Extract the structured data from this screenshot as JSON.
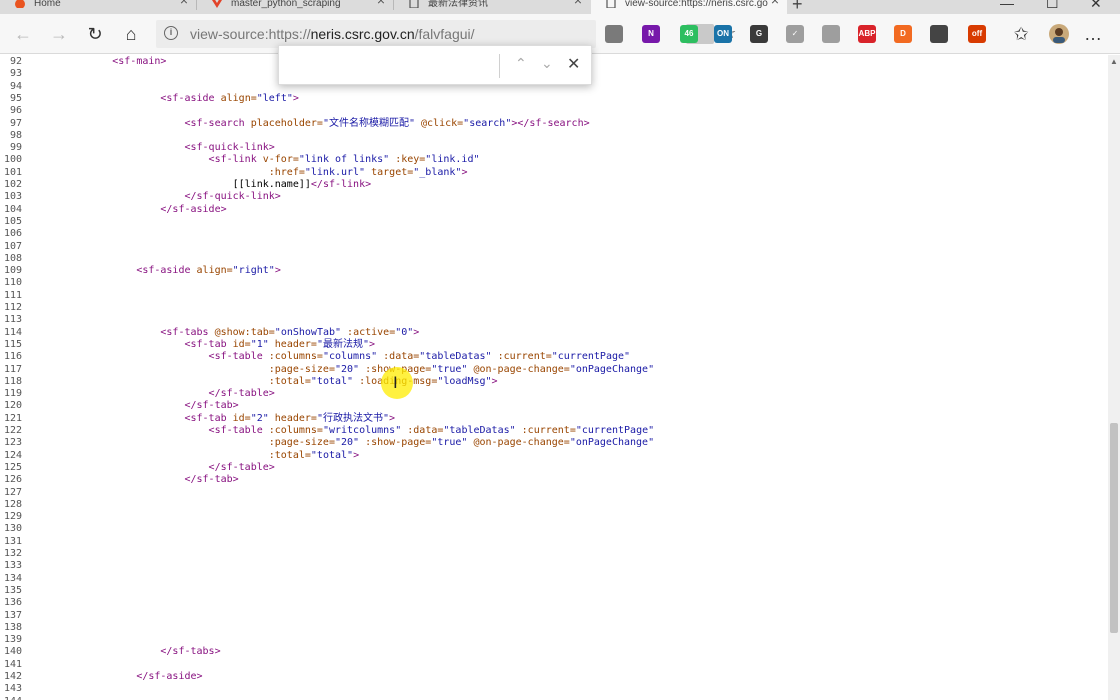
{
  "tabs": [
    {
      "label": "Home",
      "icon": "ubuntu-icon",
      "active": false
    },
    {
      "label": "master_python_scraping",
      "icon": "gitlab-icon",
      "active": false
    },
    {
      "label": "最新法律资讯",
      "icon": "page-icon",
      "active": false
    },
    {
      "label": "view-source:https://neris.csrc.go",
      "icon": "page-icon",
      "active": true
    }
  ],
  "address": {
    "prefix": "view-source:https://",
    "host": "neris.csrc.gov.cn",
    "path": "/falvfagui/"
  },
  "findbar": {
    "value": ""
  },
  "source_lines": [
    {
      "n": "92",
      "indent": 6,
      "tokens": [
        {
          "t": "tag",
          "v": "<sf-main>"
        }
      ]
    },
    {
      "n": "93",
      "indent": 0,
      "tokens": []
    },
    {
      "n": "94",
      "indent": 0,
      "tokens": []
    },
    {
      "n": "95",
      "indent": 10,
      "tokens": [
        {
          "t": "tag",
          "v": "<sf-aside "
        },
        {
          "t": "attr",
          "v": "align="
        },
        {
          "t": "val",
          "v": "\"left\""
        },
        {
          "t": "tag",
          "v": ">"
        }
      ]
    },
    {
      "n": "96",
      "indent": 0,
      "tokens": []
    },
    {
      "n": "97",
      "indent": 12,
      "tokens": [
        {
          "t": "tag",
          "v": "<sf-search "
        },
        {
          "t": "attr",
          "v": "placeholder="
        },
        {
          "t": "val",
          "v": "\"文件名称模糊匹配\""
        },
        {
          "t": "attr",
          "v": " @click="
        },
        {
          "t": "val",
          "v": "\"search\""
        },
        {
          "t": "tag",
          "v": "></sf-search>"
        }
      ]
    },
    {
      "n": "98",
      "indent": 0,
      "tokens": []
    },
    {
      "n": "99",
      "indent": 12,
      "tokens": [
        {
          "t": "tag",
          "v": "<sf-quick-link>"
        }
      ]
    },
    {
      "n": "100",
      "indent": 14,
      "tokens": [
        {
          "t": "tag",
          "v": "<sf-link "
        },
        {
          "t": "attr",
          "v": "v-for="
        },
        {
          "t": "val",
          "v": "\"link of links\""
        },
        {
          "t": "attr",
          "v": " :key="
        },
        {
          "t": "val",
          "v": "\"link.id\""
        }
      ]
    },
    {
      "n": "101",
      "indent": 19,
      "tokens": [
        {
          "t": "attr",
          "v": ":href="
        },
        {
          "t": "val",
          "v": "\"link.url\""
        },
        {
          "t": "attr",
          "v": " target="
        },
        {
          "t": "val",
          "v": "\"_blank\""
        },
        {
          "t": "tag",
          "v": ">"
        }
      ]
    },
    {
      "n": "102",
      "indent": 16,
      "tokens": [
        {
          "t": "txt",
          "v": "[[link.name]]"
        },
        {
          "t": "tag",
          "v": "</sf-link>"
        }
      ]
    },
    {
      "n": "103",
      "indent": 12,
      "tokens": [
        {
          "t": "tag",
          "v": "</sf-quick-link>"
        }
      ]
    },
    {
      "n": "104",
      "indent": 10,
      "tokens": [
        {
          "t": "tag",
          "v": "</sf-aside>"
        }
      ]
    },
    {
      "n": "105",
      "indent": 0,
      "tokens": []
    },
    {
      "n": "106",
      "indent": 0,
      "tokens": []
    },
    {
      "n": "107",
      "indent": 0,
      "tokens": []
    },
    {
      "n": "108",
      "indent": 0,
      "tokens": []
    },
    {
      "n": "109",
      "indent": 8,
      "tokens": [
        {
          "t": "tag",
          "v": "<sf-aside "
        },
        {
          "t": "attr",
          "v": "align="
        },
        {
          "t": "val",
          "v": "\"right\""
        },
        {
          "t": "tag",
          "v": ">"
        }
      ]
    },
    {
      "n": "110",
      "indent": 0,
      "tokens": []
    },
    {
      "n": "111",
      "indent": 0,
      "tokens": []
    },
    {
      "n": "112",
      "indent": 0,
      "tokens": []
    },
    {
      "n": "113",
      "indent": 0,
      "tokens": []
    },
    {
      "n": "114",
      "indent": 10,
      "tokens": [
        {
          "t": "tag",
          "v": "<sf-tabs "
        },
        {
          "t": "attr",
          "v": "@show:tab="
        },
        {
          "t": "val",
          "v": "\"onShowTab\""
        },
        {
          "t": "attr",
          "v": " :active="
        },
        {
          "t": "val",
          "v": "\"0\""
        },
        {
          "t": "tag",
          "v": ">"
        }
      ]
    },
    {
      "n": "115",
      "indent": 12,
      "tokens": [
        {
          "t": "tag",
          "v": "<sf-tab "
        },
        {
          "t": "attr",
          "v": "id="
        },
        {
          "t": "val",
          "v": "\"1\""
        },
        {
          "t": "attr",
          "v": " header="
        },
        {
          "t": "val",
          "v": "\"最新法规\""
        },
        {
          "t": "tag",
          "v": ">"
        }
      ]
    },
    {
      "n": "116",
      "indent": 14,
      "tokens": [
        {
          "t": "tag",
          "v": "<sf-table "
        },
        {
          "t": "attr",
          "v": ":columns="
        },
        {
          "t": "val",
          "v": "\"columns\""
        },
        {
          "t": "attr",
          "v": " :data="
        },
        {
          "t": "val",
          "v": "\"tableDatas\""
        },
        {
          "t": "attr",
          "v": " :current="
        },
        {
          "t": "val",
          "v": "\"currentPage\""
        }
      ]
    },
    {
      "n": "117",
      "indent": 19,
      "tokens": [
        {
          "t": "attr",
          "v": ":page-size="
        },
        {
          "t": "val",
          "v": "\"20\""
        },
        {
          "t": "attr",
          "v": " :show-page="
        },
        {
          "t": "val",
          "v": "\"true\""
        },
        {
          "t": "attr",
          "v": " @on-page-change="
        },
        {
          "t": "val",
          "v": "\"onPageChange\""
        }
      ]
    },
    {
      "n": "118",
      "indent": 19,
      "tokens": [
        {
          "t": "attr",
          "v": ":total="
        },
        {
          "t": "val",
          "v": "\"total\""
        },
        {
          "t": "attr",
          "v": " :loading-msg="
        },
        {
          "t": "val",
          "v": "\"loadMsg\""
        },
        {
          "t": "tag",
          "v": ">"
        }
      ]
    },
    {
      "n": "119",
      "indent": 14,
      "tokens": [
        {
          "t": "tag",
          "v": "</sf-table>"
        }
      ]
    },
    {
      "n": "120",
      "indent": 12,
      "tokens": [
        {
          "t": "tag",
          "v": "</sf-tab>"
        }
      ]
    },
    {
      "n": "121",
      "indent": 12,
      "tokens": [
        {
          "t": "tag",
          "v": "<sf-tab "
        },
        {
          "t": "attr",
          "v": "id="
        },
        {
          "t": "val",
          "v": "\"2\""
        },
        {
          "t": "attr",
          "v": " header="
        },
        {
          "t": "val",
          "v": "\"行政执法文书\""
        },
        {
          "t": "tag",
          "v": ">"
        }
      ]
    },
    {
      "n": "122",
      "indent": 14,
      "tokens": [
        {
          "t": "tag",
          "v": "<sf-table "
        },
        {
          "t": "attr",
          "v": ":columns="
        },
        {
          "t": "val",
          "v": "\"writcolumns\""
        },
        {
          "t": "attr",
          "v": " :data="
        },
        {
          "t": "val",
          "v": "\"tableDatas\""
        },
        {
          "t": "attr",
          "v": " :current="
        },
        {
          "t": "val",
          "v": "\"currentPage\""
        }
      ]
    },
    {
      "n": "123",
      "indent": 19,
      "tokens": [
        {
          "t": "attr",
          "v": ":page-size="
        },
        {
          "t": "val",
          "v": "\"20\""
        },
        {
          "t": "attr",
          "v": " :show-page="
        },
        {
          "t": "val",
          "v": "\"true\""
        },
        {
          "t": "attr",
          "v": " @on-page-change="
        },
        {
          "t": "val",
          "v": "\"onPageChange\""
        }
      ]
    },
    {
      "n": "124",
      "indent": 19,
      "tokens": [
        {
          "t": "attr",
          "v": ":total="
        },
        {
          "t": "val",
          "v": "\"total\""
        },
        {
          "t": "tag",
          "v": ">"
        }
      ]
    },
    {
      "n": "125",
      "indent": 14,
      "tokens": [
        {
          "t": "tag",
          "v": "</sf-table>"
        }
      ]
    },
    {
      "n": "126",
      "indent": 12,
      "tokens": [
        {
          "t": "tag",
          "v": "</sf-tab>"
        }
      ]
    },
    {
      "n": "127",
      "indent": 0,
      "tokens": []
    },
    {
      "n": "128",
      "indent": 0,
      "tokens": []
    },
    {
      "n": "129",
      "indent": 0,
      "tokens": []
    },
    {
      "n": "130",
      "indent": 0,
      "tokens": []
    },
    {
      "n": "131",
      "indent": 0,
      "tokens": []
    },
    {
      "n": "132",
      "indent": 0,
      "tokens": []
    },
    {
      "n": "133",
      "indent": 0,
      "tokens": []
    },
    {
      "n": "134",
      "indent": 0,
      "tokens": []
    },
    {
      "n": "135",
      "indent": 0,
      "tokens": []
    },
    {
      "n": "136",
      "indent": 0,
      "tokens": []
    },
    {
      "n": "137",
      "indent": 0,
      "tokens": []
    },
    {
      "n": "138",
      "indent": 0,
      "tokens": []
    },
    {
      "n": "139",
      "indent": 0,
      "tokens": []
    },
    {
      "n": "140",
      "indent": 10,
      "tokens": [
        {
          "t": "tag",
          "v": "</sf-tabs>"
        }
      ]
    },
    {
      "n": "141",
      "indent": 0,
      "tokens": []
    },
    {
      "n": "142",
      "indent": 8,
      "tokens": [
        {
          "t": "tag",
          "v": "</sf-aside>"
        }
      ]
    },
    {
      "n": "143",
      "indent": 0,
      "tokens": []
    },
    {
      "n": "144",
      "indent": 0,
      "tokens": []
    }
  ],
  "toolbar_extensions": [
    {
      "icon": "reading-list-icon",
      "color": "#7a7a7a",
      "label": ""
    },
    {
      "icon": "onenote-icon",
      "color": "#7719aa",
      "label": "N"
    },
    {
      "icon": "evernote-icon",
      "color": "#2dbe60",
      "label": "46"
    },
    {
      "icon": "onetab-icon",
      "color": "#1a73a8",
      "label": "ON"
    },
    {
      "icon": "ghostery-icon",
      "color": "#3a3a3a",
      "label": "G"
    },
    {
      "icon": "checkmark-icon",
      "color": "#9e9e9e",
      "label": "✓"
    },
    {
      "icon": "cursor-icon",
      "color": "#9e9e9e",
      "label": ""
    },
    {
      "icon": "adblock-icon",
      "color": "#d9232a",
      "label": "ABP"
    },
    {
      "icon": "honey-icon",
      "color": "#f26a21",
      "label": "D"
    },
    {
      "icon": "screenshot-icon",
      "color": "#444444",
      "label": ""
    },
    {
      "icon": "office-icon",
      "color": "#d83b01",
      "label": "off"
    }
  ]
}
